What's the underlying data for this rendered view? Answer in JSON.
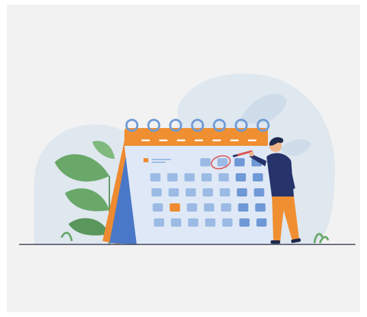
{
  "illustration": {
    "subject": "calendar",
    "month_grid": {
      "rows": 5,
      "cols": 7
    },
    "highlighted_day": {
      "row": 3,
      "col": 1
    },
    "circled_day": {
      "row": 0,
      "col": 3
    },
    "colors": {
      "background": "#f2f2f2",
      "blob": "#dfe7ef",
      "calendar_page": "#dfe8f6",
      "calendar_header": "#ef8f32",
      "calendar_back": "#4a78c8",
      "day_cell": "#9bbbe4",
      "day_cell_dark": "#6f98d6",
      "accent_orange": "#ee8a2f",
      "ring": "#6e9ad6",
      "circle_mark": "#d9534f",
      "leaf_green": "#6aa86a",
      "shirt": "#26346b",
      "pants": "#ef8f32",
      "hair": "#1f2a4d",
      "skin": "#f0b58a",
      "ground_line": "#3a3f52"
    },
    "icons": [
      "calendar-icon",
      "pencil-icon",
      "leaf-icon",
      "ring-binder-icon"
    ]
  }
}
